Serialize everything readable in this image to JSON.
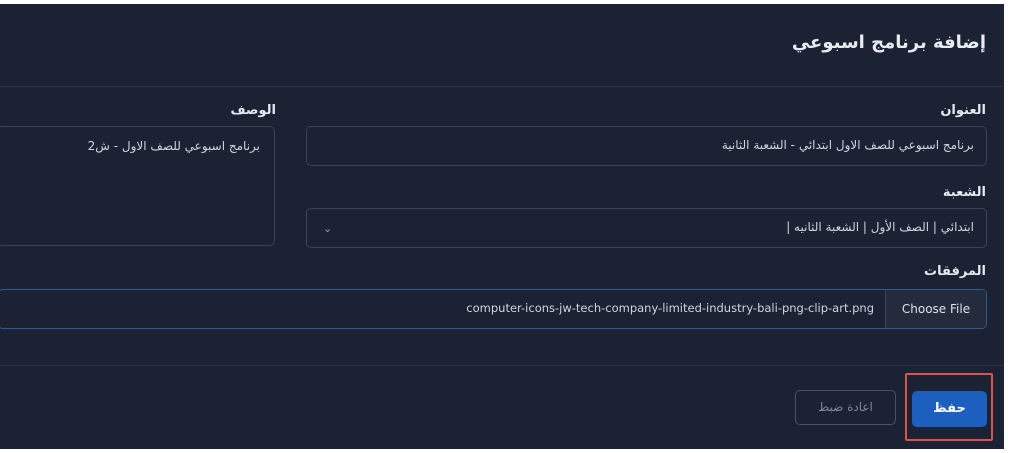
{
  "modal": {
    "title": "إضافة برنامج اسبوعي"
  },
  "form": {
    "title_label": "العنوان",
    "title_value": "برنامج اسبوعي للصف الاول ابتدائي - الشعبة الثانية",
    "description_label": "الوصف",
    "description_value": "برنامج اسبوعي للصف الاول - ش2",
    "section_label": "الشعبة",
    "section_value": "ابتدائي | الصف الأول | الشعبة الثانيه |",
    "attachments_label": "المرفقات",
    "file_button_label": "Choose File",
    "file_name": "computer-icons-jw-tech-company-limited-industry-bali-png-clip-art.png"
  },
  "footer": {
    "reset_label": "اعادة ضبط",
    "save_label": "حفظ"
  },
  "icons": {
    "select_chevron": "chevron-down-icon"
  },
  "colors": {
    "background": "#1b2233",
    "primary": "#1d5fbf",
    "highlight": "#d9534f"
  }
}
